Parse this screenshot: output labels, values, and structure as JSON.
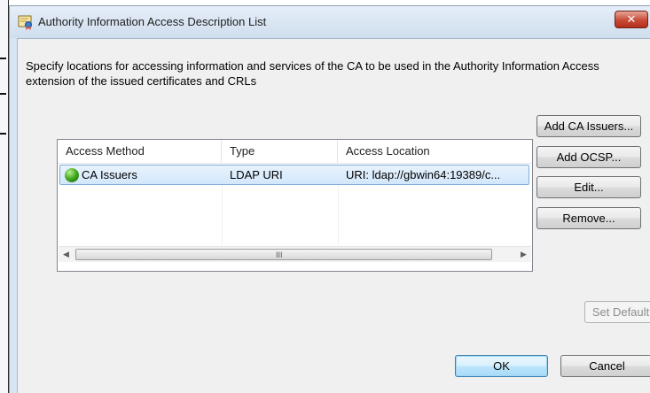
{
  "window": {
    "title": "Authority Information Access Description List",
    "close_glyph": "✕"
  },
  "description": "Specify locations for accessing information and services of the CA to be used in the Authority Information Access extension of the issued certificates and CRLs",
  "list": {
    "columns": [
      "Access Method",
      "Type",
      "Access Location"
    ],
    "rows": [
      {
        "method": "CA Issuers",
        "type": "LDAP URI",
        "location": "URI: ldap://gbwin64:19389/c...",
        "icon": "globe-icon"
      }
    ],
    "scroll_grip": "III"
  },
  "buttons": {
    "add_ca_issuers": "Add CA Issuers...",
    "add_ocsp": "Add OCSP...",
    "edit": "Edit...",
    "remove": "Remove...",
    "set_default": "Set Default",
    "ok": "OK",
    "cancel": "Cancel"
  },
  "colors": {
    "selection": "#d3e7fb",
    "close_button": "#c74a36",
    "frame": "#d7e4f2"
  }
}
